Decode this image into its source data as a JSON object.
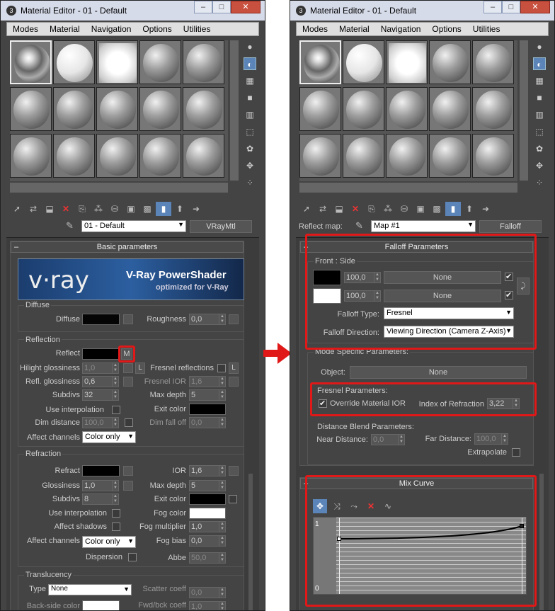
{
  "left": {
    "title": "Material Editor - 01 - Default",
    "menu": [
      "Modes",
      "Material",
      "Navigation",
      "Options",
      "Utilities"
    ],
    "material_name": "01 - Default",
    "material_type": "VRayMtl",
    "basic_rollout": "Basic parameters",
    "banner": {
      "logo": "v·ray",
      "line1": "V-Ray PowerShader",
      "line2": "optimized for V-Ray"
    },
    "diffuse": {
      "group": "Diffuse",
      "diffuse_label": "Diffuse",
      "roughness_label": "Roughness",
      "roughness": "0,0",
      "diffuse_color": "#050505"
    },
    "reflection": {
      "group": "Reflection",
      "reflect_label": "Reflect",
      "map_button": "M",
      "hilight_label": "Hilight glossiness",
      "hilight": "1,0",
      "l_button": "L",
      "fresnel_label": "Fresnel reflections",
      "fresnel_l": "L",
      "refl_gloss_label": "Refl. glossiness",
      "refl_gloss": "0,6",
      "fresnel_ior_label": "Fresnel IOR",
      "fresnel_ior": "1,6",
      "subdivs_label": "Subdivs",
      "subdivs": "32",
      "max_depth_label": "Max depth",
      "max_depth": "5",
      "use_interp_label": "Use interpolation",
      "exit_color_label": "Exit color",
      "dim_distance_label": "Dim distance",
      "dim_distance": "100,0",
      "dim_falloff_label": "Dim fall off",
      "dim_falloff": "0,0",
      "affect_channels_label": "Affect channels",
      "affect_channels": "Color only"
    },
    "refraction": {
      "group": "Refraction",
      "refract_label": "Refract",
      "ior_label": "IOR",
      "ior": "1,6",
      "gloss_label": "Glossiness",
      "gloss": "1,0",
      "max_depth_label": "Max depth",
      "max_depth": "5",
      "subdivs_label": "Subdivs",
      "subdivs": "8",
      "exit_color_label": "Exit color",
      "use_interp_label": "Use interpolation",
      "fog_color_label": "Fog color",
      "affect_shadows_label": "Affect shadows",
      "fog_mult_label": "Fog multiplier",
      "fog_mult": "1,0",
      "affect_channels_label": "Affect channels",
      "affect_channels": "Color only",
      "fog_bias_label": "Fog bias",
      "fog_bias": "0,0",
      "dispersion_label": "Dispersion",
      "abbe_label": "Abbe",
      "abbe": "50,0"
    },
    "translucency": {
      "group": "Translucency",
      "type_label": "Type",
      "type": "None",
      "scatter_label": "Scatter coeff",
      "scatter": "0,0",
      "back_side_label": "Back-side color",
      "fwd_label": "Fwd/bck coeff",
      "fwd": "1,0"
    }
  },
  "right": {
    "title": "Material Editor - 01 - Default",
    "menu": [
      "Modes",
      "Material",
      "Navigation",
      "Options",
      "Utilities"
    ],
    "reflect_map_label": "Reflect map:",
    "map_name": "Map #1",
    "map_type": "Falloff",
    "falloff_rollout": "Falloff Parameters",
    "front_side": "Front : Side",
    "row1_value": "100,0",
    "row1_map": "None",
    "row2_value": "100,0",
    "row2_map": "None",
    "falloff_type_label": "Falloff Type:",
    "falloff_type": "Fresnel",
    "falloff_dir_label": "Falloff Direction:",
    "falloff_dir": "Viewing Direction (Camera Z-Axis)",
    "mode_specific": "Mode Specific Parameters:",
    "object_label": "Object:",
    "object_value": "None",
    "fresnel_params": "Fresnel Parameters:",
    "override_ior_label": "Override Material IOR",
    "ior_label": "Index of Refraction",
    "ior": "3,22",
    "distance_blend": "Distance Blend Parameters:",
    "near_label": "Near Distance:",
    "near": "0,0",
    "far_label": "Far Distance:",
    "far": "100,0",
    "extrapolate_label": "Extrapolate",
    "mix_curve": "Mix Curve",
    "curve_top": "1",
    "curve_bottom": "0"
  },
  "colors": {
    "accent": "#e01818",
    "active": "#5b84b8"
  }
}
